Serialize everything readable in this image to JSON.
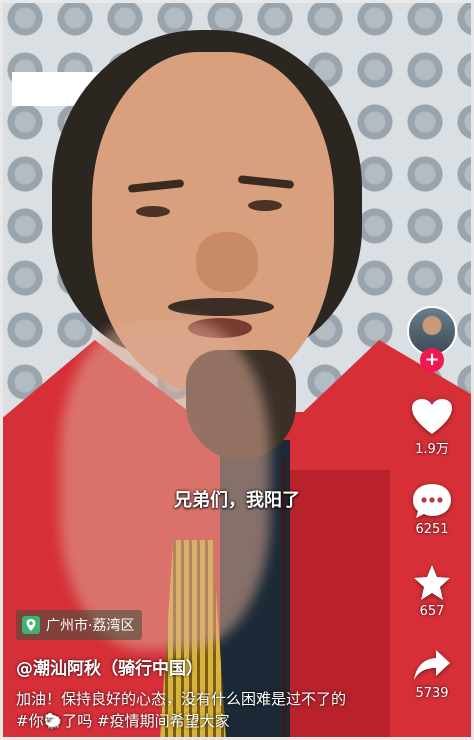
{
  "caption": "兄弟们，我阳了",
  "location": {
    "label": "广州市·荔湾区",
    "icon": "map-pin-icon"
  },
  "author": "@潮汕阿秋（骑行中国）",
  "description": "加油！保持良好的心态，没有什么困难是过不了的#你🐑了吗 #疫情期间希望大家",
  "rail": {
    "avatar_follow_symbol": "+",
    "likes": "1.9万",
    "comments": "6251",
    "favorites": "657",
    "shares": "5739"
  },
  "colors": {
    "follow_badge": "#f0194f",
    "jacket": "#d72f38"
  }
}
